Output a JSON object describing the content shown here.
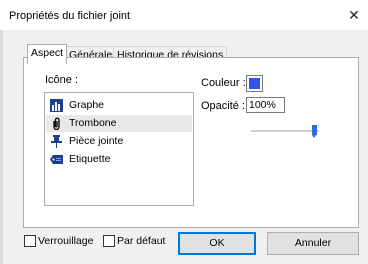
{
  "window": {
    "title": "Propriétés du fichier joint",
    "close_glyph": "✕"
  },
  "tabs": [
    {
      "label": "Aspect"
    },
    {
      "label": "Générales"
    },
    {
      "label": "Historique de révisions"
    }
  ],
  "aspect": {
    "icon_label": "Icône :",
    "icons": [
      {
        "label": "Graphe",
        "icon": "graph-icon"
      },
      {
        "label": "Trombone",
        "icon": "paperclip-icon"
      },
      {
        "label": "Pièce jointe",
        "icon": "pushpin-icon"
      },
      {
        "label": "Etiquette",
        "icon": "tag-icon"
      }
    ],
    "selected_icon": "Trombone",
    "color_label": "Couleur :",
    "color_value": "#3355ee",
    "opacity_label": "Opacité :",
    "opacity_value": "100%",
    "opacity_slider_level": 1.0
  },
  "footer": {
    "lock_label": "Verrouillage",
    "lock_checked": false,
    "default_label": "Par défaut",
    "default_checked": false,
    "ok_label": "OK",
    "cancel_label": "Annuler"
  }
}
